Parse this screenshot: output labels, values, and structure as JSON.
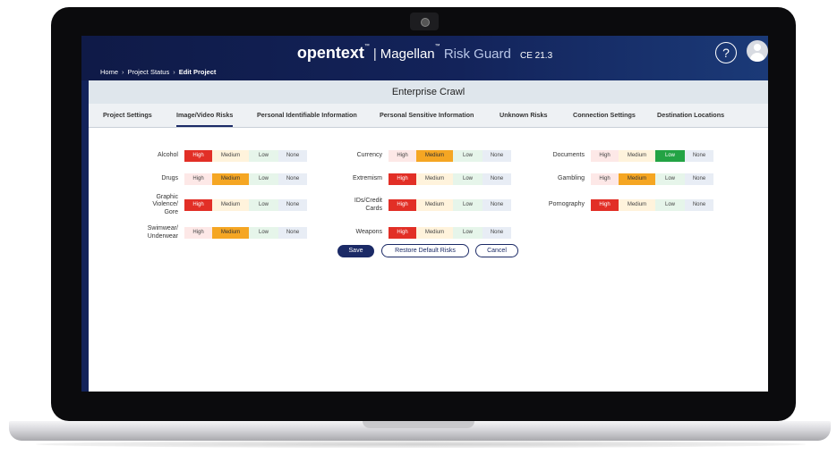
{
  "app": {
    "brand_logo": "opentext",
    "brand_tm": "™",
    "product_name": "Magellan",
    "product_tm": "™",
    "product_sub": "Risk Guard",
    "version": "CE 21.3",
    "help_label": "?"
  },
  "breadcrumb": {
    "items": [
      "Home",
      "Project Status",
      "Edit Project"
    ],
    "separator": "›"
  },
  "page_title": "Enterprise Crawl",
  "tabs": [
    {
      "label": "Project Settings"
    },
    {
      "label": "Image/Video Risks"
    },
    {
      "label": "Personal Identifiable Information"
    },
    {
      "label": "Personal Sensitive Information"
    },
    {
      "label": "Unknown Risks"
    },
    {
      "label": "Connection Settings"
    },
    {
      "label": "Destination Locations"
    }
  ],
  "active_tab": "Image/Video Risks",
  "level_labels": [
    "High",
    "Medium",
    "Low",
    "None"
  ],
  "risks": [
    {
      "label": "Alcohol",
      "selected": "High"
    },
    {
      "label": "Drugs",
      "selected": "Medium"
    },
    {
      "label": "Graphic Violence/ Gore",
      "selected": "High"
    },
    {
      "label": "Swimwear/ Underwear",
      "selected": "Medium"
    },
    {
      "label": "Currency",
      "selected": "Medium"
    },
    {
      "label": "Extremism",
      "selected": "High"
    },
    {
      "label": "IDs/Credit Cards",
      "selected": "High"
    },
    {
      "label": "Weapons",
      "selected": "High"
    },
    {
      "label": "Documents",
      "selected": "Low"
    },
    {
      "label": "Gambling",
      "selected": "Medium"
    },
    {
      "label": "Pornography",
      "selected": "High"
    }
  ],
  "actions": {
    "save": "Save",
    "restore": "Restore Default Risks",
    "cancel": "Cancel"
  },
  "colors": {
    "header_navy": "#13235a",
    "high_selected": "#e22f26",
    "medium_selected": "#f5a623",
    "low_selected": "#23a344",
    "button_primary": "#1b2a66"
  }
}
